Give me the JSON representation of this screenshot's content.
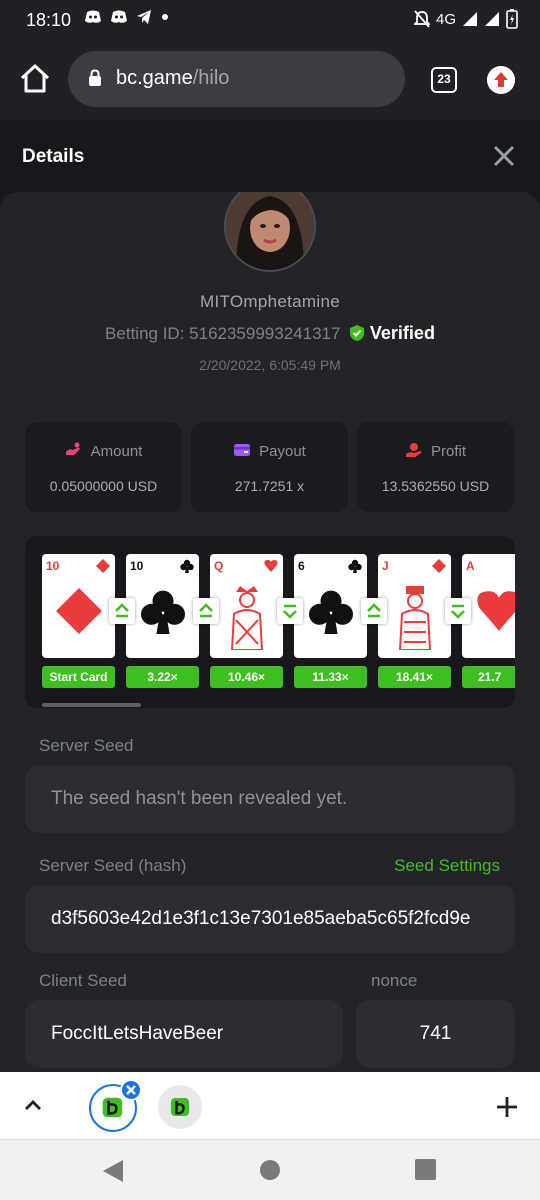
{
  "status_bar": {
    "time": "18:10",
    "network": "4G"
  },
  "browser": {
    "url_host": "bc.game",
    "url_path": "/hilo",
    "tab_count": "23"
  },
  "details": {
    "title": "Details",
    "username": "MITOmphetamine",
    "betting_id_label": "Betting ID:",
    "betting_id": "5162359993241317",
    "verified_label": "Verified",
    "date": "2/20/2022, 6:05:49 PM"
  },
  "stats": [
    {
      "label": "Amount",
      "value": "0.05000000 USD",
      "icon": "amount-icon",
      "color": "#e8457a"
    },
    {
      "label": "Payout",
      "value": "271.7251 x",
      "icon": "payout-icon",
      "color": "#9b59ff"
    },
    {
      "label": "Profit",
      "value": "13.5362550 USD",
      "icon": "profit-icon",
      "color": "#ea3c3c"
    }
  ],
  "cards": [
    {
      "rank": "10",
      "suit": "diamond",
      "multiplier": "Start Card"
    },
    {
      "rank": "10",
      "suit": "club",
      "multiplier": "3.22×",
      "guess": "higher"
    },
    {
      "rank": "Q",
      "suit": "heart",
      "multiplier": "10.46×",
      "guess": "higher"
    },
    {
      "rank": "6",
      "suit": "club",
      "multiplier": "11.33×",
      "guess": "lower"
    },
    {
      "rank": "J",
      "suit": "diamond",
      "multiplier": "18.41×",
      "guess": "higher"
    },
    {
      "rank": "A",
      "suit": "heart",
      "multiplier": "21.7",
      "guess": "lower"
    }
  ],
  "fields": {
    "server_seed_label": "Server Seed",
    "server_seed_value": "The seed hasn't been revealed yet.",
    "server_hash_label": "Server Seed (hash)",
    "seed_settings_label": "Seed Settings",
    "server_hash_value": "d3f5603e42d1e3f1c13e7301e85aeba5c65f2fcd9e",
    "client_seed_label": "Client Seed",
    "client_seed_value": "FoccItLetsHaveBeer",
    "nonce_label": "nonce",
    "nonce_value": "741"
  },
  "colors": {
    "accent_green": "#3fbe1f",
    "panel": "#232427",
    "field": "#2c2d31"
  }
}
